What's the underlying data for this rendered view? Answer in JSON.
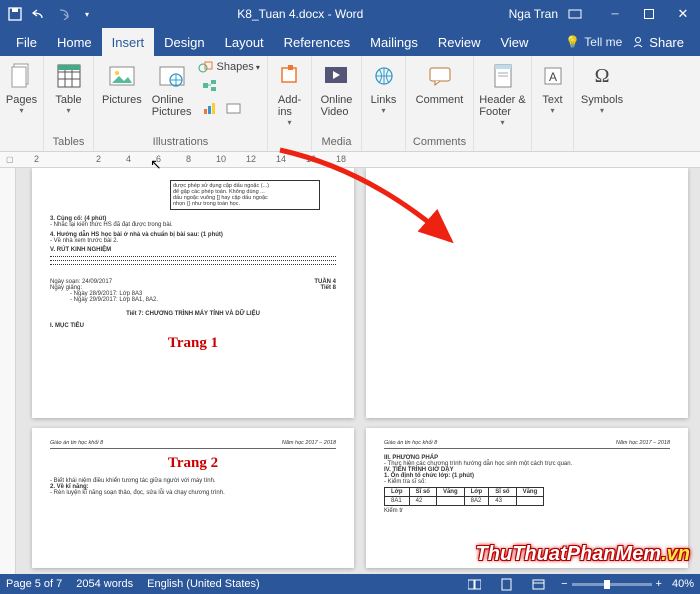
{
  "titlebar": {
    "doc_title": "K8_Tuan 4.docx - Word",
    "user": "Nga Tran"
  },
  "tabs": {
    "file": "File",
    "home": "Home",
    "insert": "Insert",
    "design": "Design",
    "layout": "Layout",
    "references": "References",
    "mailings": "Mailings",
    "review": "Review",
    "view": "View",
    "tell_me": "Tell me",
    "share": "Share"
  },
  "ribbon": {
    "pages": {
      "label": "Pages",
      "btn": "Pages"
    },
    "tables": {
      "label": "Tables",
      "btn": "Table"
    },
    "illustrations": {
      "label": "Illustrations",
      "pictures": "Pictures",
      "online_pictures": "Online\nPictures",
      "shapes": "Shapes"
    },
    "addins": {
      "label": " ",
      "btn": "Add-\nins"
    },
    "media": {
      "label": "Media",
      "btn": "Online\nVideo"
    },
    "links": {
      "btn": "Links"
    },
    "comments": {
      "label": "Comments",
      "btn": "Comment"
    },
    "header_footer": {
      "btn": "Header &\nFooter"
    },
    "text": {
      "btn": "Text"
    },
    "symbols": {
      "btn": "Symbols"
    }
  },
  "ruler": {
    "ticks": [
      "2",
      "2",
      "4",
      "6",
      "8",
      "10",
      "12",
      "14",
      "16",
      "18"
    ]
  },
  "page1": {
    "boxed": "được phép sử dụng cặp dấu ngoặc (...)\nđể gặp các phép toán. Không dùng ...\ndấu ngoặc vuông [] hay cặp dấu ngoặc\nnhọn {} như trong toán học.",
    "line1": "3. Củng cố: (4 phút)",
    "line2": "- Nhắc lại kiến thức HS đã đạt được trong bài.",
    "line3": "4. Hướng dẫn HS học bài ở nhà và chuẩn bị bài sau: (1 phút)",
    "line4": "- Về nhà xem trước bài 2.",
    "line5": "V. RÚT KINH NGHIỆM",
    "soanL": "Ngày soạn: 24/09/2017",
    "soanR": "TUẦN 4",
    "giangL": "Ngày giảng:",
    "giangR": "Tiết 8",
    "g1": "- Ngày 28/9/2017: Lớp 8A3",
    "g2": "- Ngày 29/9/2017: Lớp 8A1, 8A2.",
    "tiet": "Tiết 7: CHƯƠNG TRÌNH MÁY TÍNH VÀ DỮ LIỆU",
    "muc": "I. MỤC TIÊU",
    "trang": "Trang 1"
  },
  "page3": {
    "hdrL": "Giáo án tin học khối 8",
    "hdrR": "Năm học 2017 – 2018",
    "trang": "Trang 2",
    "l1": "- Biết khái niệm điều khiển tương tác giữa người với máy tính.",
    "l2": "2. Về kĩ năng:",
    "l3": "- Rèn luyện kĩ năng soạn thảo, đọc, sửa lỗi và chạy chương trình."
  },
  "page4": {
    "hdrL": "Giáo án tin học khối 8",
    "hdrR": "Năm học 2017 – 2018",
    "h1": "III. PHƯƠNG PHÁP",
    "h1b": "- Thực hiện các chương trình hướng dẫn học sinh một cách trực quan.",
    "h2": "IV. TIẾN TRÌNH GIỜ DẠY",
    "h3": "1. Ổn định tổ chức lớp: (1 phút)",
    "h4": "- Kiểm tra sĩ số:",
    "table": {
      "head": [
        "Lớp",
        "Sĩ số",
        "Vắng",
        "Lớp",
        "Sĩ số",
        "Vắng"
      ],
      "row": [
        "8A1",
        "42",
        "",
        "8A2",
        "43",
        ""
      ]
    },
    "h5": "Kiểm tr"
  },
  "status": {
    "page": "Page 5 of 7",
    "words": "2054 words",
    "lang": "English (United States)",
    "zoom": "40%"
  },
  "watermark": {
    "main": "ThuThuatPhanMem",
    "vn": ".vn"
  }
}
